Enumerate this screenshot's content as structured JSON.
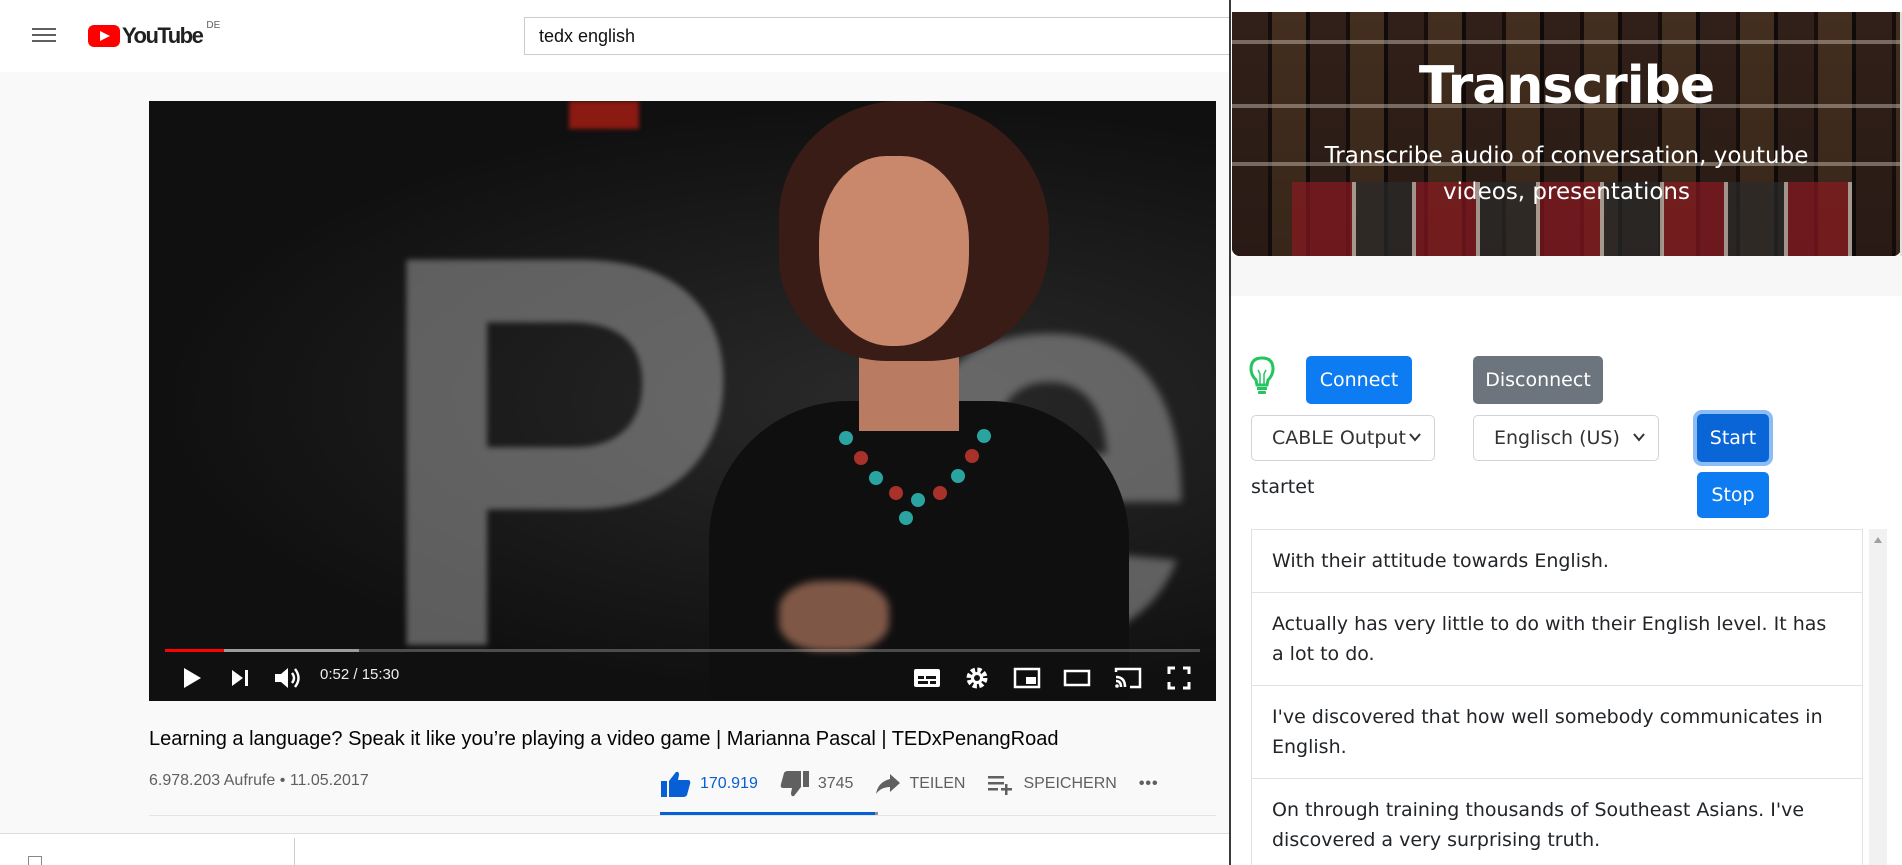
{
  "youtube": {
    "logo_text": "YouTube",
    "region": "DE",
    "search_value": "tedx english",
    "player": {
      "time": "0:52 / 15:30",
      "progress_played": 0.057,
      "progress_loaded": 0.187
    },
    "video": {
      "title": "Learning a language? Speak it like you’re playing a video game | Marianna Pascal | TEDxPenangRoad",
      "meta": "6.978.203 Aufrufe • 11.05.2017",
      "likes": "170.919",
      "dislikes": "3745",
      "share_label": "TEILEN",
      "save_label": "SPEICHERN",
      "more_label": "•••"
    },
    "colors": {
      "brand_red": "#ff0000",
      "like_blue": "#065fd4"
    }
  },
  "transcribe": {
    "title": "Transcribe",
    "subtitle": "Transcribe audio of conversation, youtube videos, presentations",
    "connect_label": "Connect",
    "disconnect_label": "Disconnect",
    "input_device": "CABLE Output",
    "language": "Englisch (US)",
    "start_label": "Start",
    "stop_label": "Stop",
    "status": "startet",
    "transcript": [
      "With their attitude towards English.",
      "Actually has very little to do with their English level. It has a lot to do.",
      "I've discovered that how well somebody communicates in English.",
      "On through training thousands of Southeast Asians. I've discovered a very surprising truth."
    ],
    "colors": {
      "primary": "#0d7cf2",
      "secondary": "#6c757d",
      "bulb": "#22c55e"
    }
  }
}
